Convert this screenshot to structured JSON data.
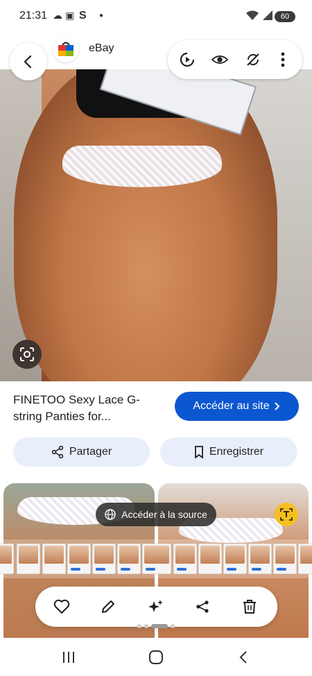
{
  "status": {
    "time": "21:31",
    "battery": "60"
  },
  "header": {
    "site_name": "eBay"
  },
  "product": {
    "title": "FINETOO Sexy Lace G-string Panties for...",
    "visit_label": "Accéder au site",
    "share_label": "Partager",
    "save_label": "Enregistrer"
  },
  "related": {
    "source_label": "Accéder à la source"
  },
  "colors": {
    "accent": "#0b57d0",
    "pill": "#e8effa"
  },
  "icons": [
    "back-icon",
    "replay-icon",
    "eye-icon",
    "sync-off-icon",
    "more-icon",
    "lens-icon",
    "share-icon",
    "bookmark-icon",
    "globe-icon",
    "heart-icon",
    "edit-icon",
    "sparkle-icon",
    "delete-icon"
  ]
}
